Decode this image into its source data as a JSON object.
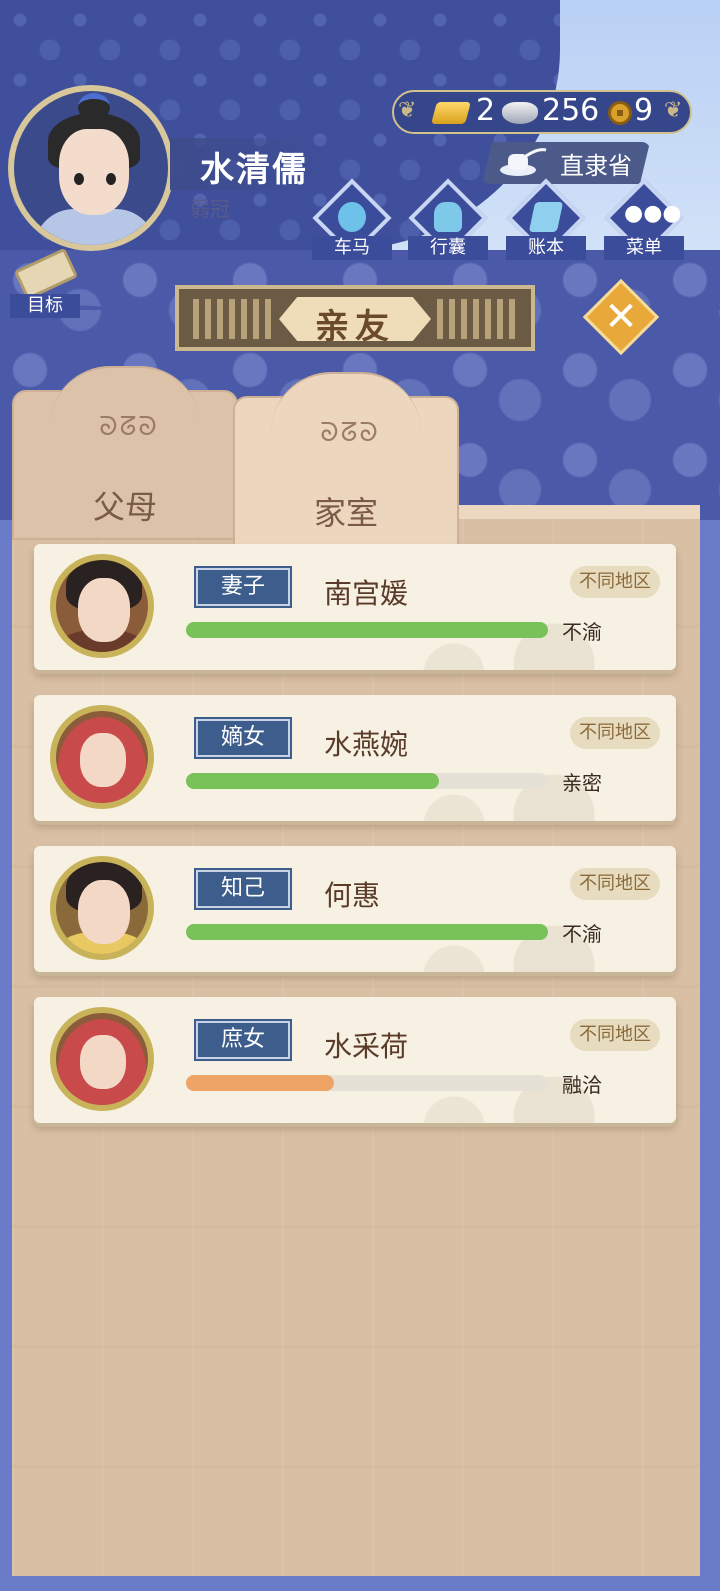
{
  "player": {
    "name": "水清儒",
    "age_title": "弱冠"
  },
  "currency": {
    "gold": "2",
    "silver": "256",
    "coin": "9"
  },
  "location": "直隶省",
  "menu": [
    {
      "label": "车马",
      "icon": "carriage-icon"
    },
    {
      "label": "行囊",
      "icon": "bag-icon"
    },
    {
      "label": "账本",
      "icon": "ledger-icon"
    },
    {
      "label": "菜单",
      "icon": "menu-dots-icon"
    }
  ],
  "goal_label": "目标",
  "title": "亲友",
  "tabs": [
    {
      "label": "父母"
    },
    {
      "label": "家室"
    }
  ],
  "members": [
    {
      "role": "妻子",
      "name": "南宫媛",
      "region": "不同地区",
      "mood": "不渝",
      "bond": 1.0,
      "bar_color": "#79c25a"
    },
    {
      "role": "嫡女",
      "name": "水燕婉",
      "region": "不同地区",
      "mood": "亲密",
      "bond": 0.7,
      "bar_color": "#79c25a"
    },
    {
      "role": "知己",
      "name": "何惠",
      "region": "不同地区",
      "mood": "不渝",
      "bond": 1.0,
      "bar_color": "#79c25a"
    },
    {
      "role": "庶女",
      "name": "水采荷",
      "region": "不同地区",
      "mood": "融洽",
      "bond": 0.41,
      "bar_color": "#eea464"
    }
  ]
}
